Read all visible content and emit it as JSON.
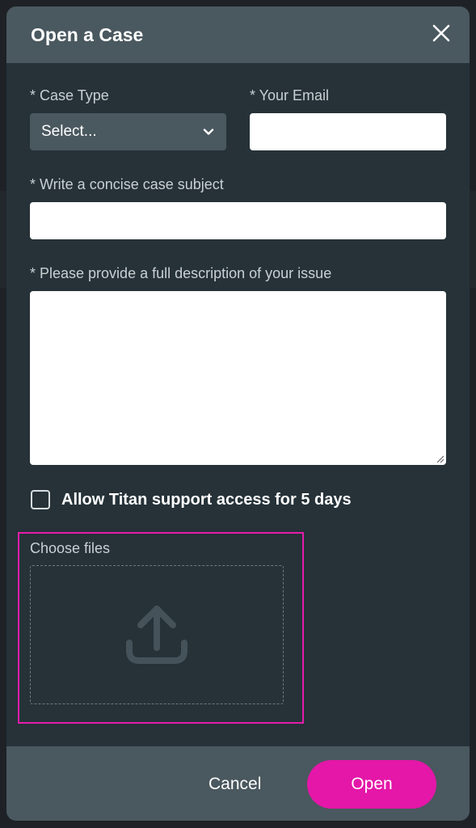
{
  "dialog": {
    "title": "Open a Case",
    "close_icon": "close-icon"
  },
  "form": {
    "case_type": {
      "label": "* Case Type",
      "selected": "Select...",
      "icon": "chevron-down-icon"
    },
    "email": {
      "label": "* Your Email",
      "value": ""
    },
    "subject": {
      "label": "* Write a concise case subject",
      "value": ""
    },
    "description": {
      "label": "* Please provide a full description of your issue",
      "value": ""
    },
    "support_access": {
      "label": "Allow Titan support access for 5 days",
      "checked": false
    },
    "files": {
      "label": "Choose files",
      "icon": "upload-icon"
    }
  },
  "footer": {
    "cancel_label": "Cancel",
    "open_label": "Open"
  },
  "colors": {
    "header": "#4a585f",
    "body": "#263238",
    "accent": "#e417a8",
    "highlight": "#e61cab"
  }
}
